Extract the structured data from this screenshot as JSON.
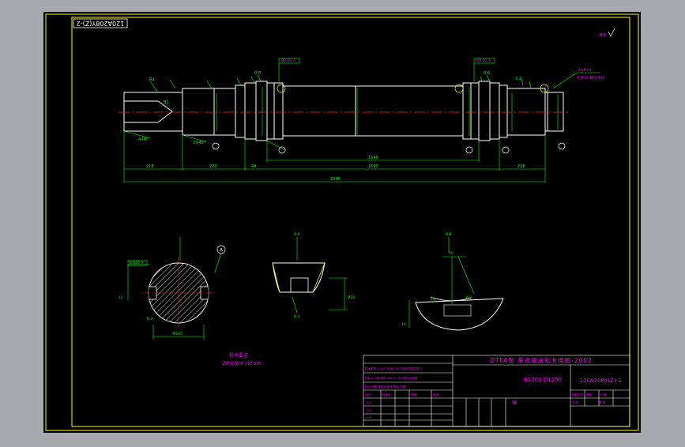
{
  "drawing": {
    "title_block": {
      "heading": "DTⅡA型  带式输送机专用图-2002",
      "belt_sizes": "B1200 D1250",
      "drawing_number": "120A208Y(Z)-2",
      "part_name": "轴"
    },
    "rotated_code": "120A208Y(Z)-2",
    "tech_requirements": {
      "heading": "技术要求",
      "item": "调质处理HB 217-255"
    },
    "callout": "A",
    "dimensions": {
      "overall_length": "2346",
      "middle_span": "1540",
      "left_end": "218",
      "right_end": "228"
    },
    "colors": {
      "sheet": "#000000",
      "frame": "#ffff00",
      "geometry": "#ffffff",
      "dimension": "#00ff00",
      "text": "#ff00ff",
      "centerline": "#ff2020",
      "gray_bg": "#a7a9ad"
    }
  }
}
